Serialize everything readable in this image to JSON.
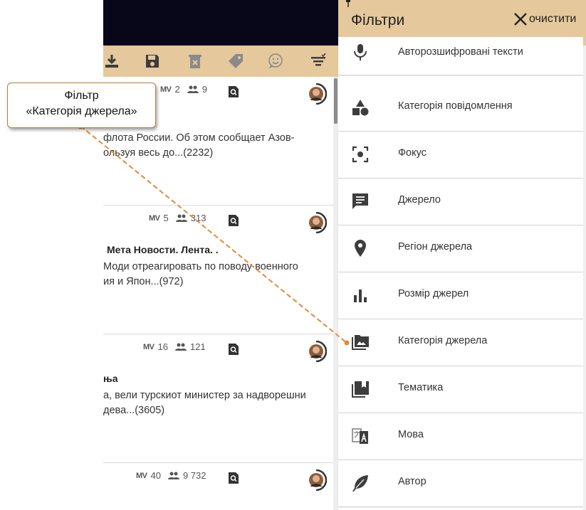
{
  "colors": {
    "accent": "#e5c89c",
    "topbar": "#080619",
    "icon": "#3d3d3d",
    "callout_line": "#e28a3b"
  },
  "toolbar": {
    "icons": [
      "download-icon",
      "save-icon",
      "delete-icon",
      "tag-icon",
      "sentiment-icon",
      "filter-list-icon"
    ]
  },
  "feed": {
    "cards": [
      {
        "mv": "MV",
        "mv_count": "2",
        "audience": "9",
        "title": "",
        "body": [
          "флота России. Об этом сообщает Азов-",
          "ользуя весь до...(2232)"
        ]
      },
      {
        "mv": "MV",
        "mv_count": "5",
        "audience": "313",
        "title": "Мета Новости. Лента. .",
        "body": [
          "Моди отреагировать по поводу военного",
          "ия и Япон...(972)"
        ]
      },
      {
        "mv": "MV",
        "mv_count": "16",
        "audience": "121",
        "title": "ња",
        "body": [
          "а, вели турскиот министер за надворешни",
          "дева...(3605)"
        ]
      },
      {
        "mv": "MV",
        "mv_count": "40",
        "audience": "9 732",
        "title": "",
        "body": []
      }
    ]
  },
  "panel": {
    "title": "Фільтри",
    "clear_label": "очистити",
    "items": [
      {
        "label": "Авторозшифровані тексти",
        "icon": "microphone-icon"
      },
      {
        "label": "Категорія повідомлення",
        "icon": "shapes-icon"
      },
      {
        "label": "Фокус",
        "icon": "focus-icon"
      },
      {
        "label": "Джерело",
        "icon": "source-list-icon"
      },
      {
        "label": "Регіон джерела",
        "icon": "location-pin-icon"
      },
      {
        "label": "Розмір джерел",
        "icon": "bar-chart-icon"
      },
      {
        "label": "Категорія джерела",
        "icon": "photo-library-icon"
      },
      {
        "label": "Тематика",
        "icon": "bookmark-library-icon"
      },
      {
        "label": "Мова",
        "icon": "translate-icon"
      },
      {
        "label": "Автор",
        "icon": "feather-icon"
      }
    ]
  },
  "callout": {
    "line1": "Фільтр",
    "line2": "«Категорія джерела»"
  }
}
